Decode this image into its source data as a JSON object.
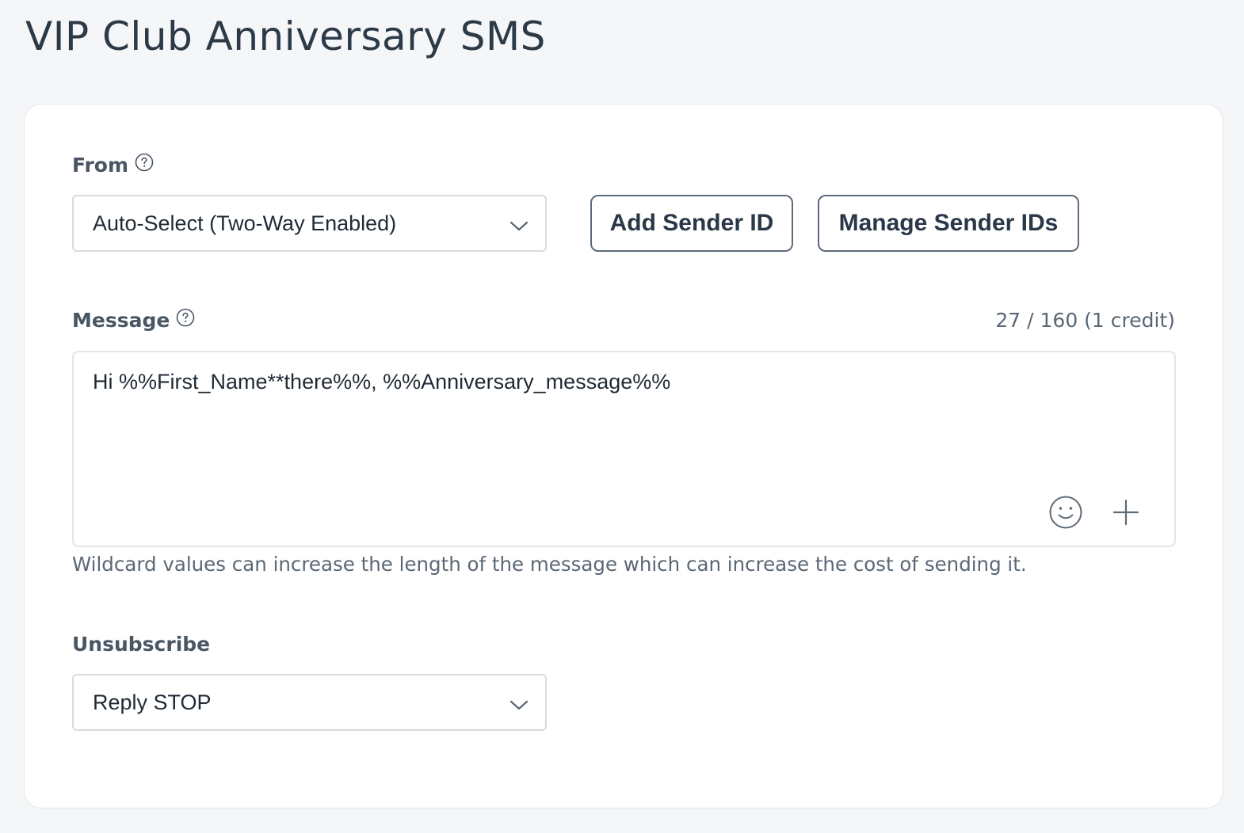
{
  "page": {
    "title": "VIP Club Anniversary SMS"
  },
  "from": {
    "label": "From",
    "selected": "Auto-Select (Two-Way Enabled)",
    "add_sender_label": "Add Sender ID",
    "manage_senders_label": "Manage Sender IDs"
  },
  "message": {
    "label": "Message",
    "counter": "27 / 160 (1 credit)",
    "value": "Hi %%First_Name**there%%, %%Anniversary_message%%",
    "hint": "Wildcard values can increase the length of the message which can increase the cost of sending it."
  },
  "unsubscribe": {
    "label": "Unsubscribe",
    "selected": "Reply STOP"
  },
  "icons": {
    "help": "help-circle-icon",
    "chevron": "chevron-down-icon",
    "emoji": "smiley-icon",
    "insert": "plus-icon"
  },
  "colors": {
    "background": "#f4f6f8",
    "card": "#ffffff",
    "text": "#2a3544",
    "muted": "#5b6775",
    "button_border": "#5c6a7a"
  }
}
